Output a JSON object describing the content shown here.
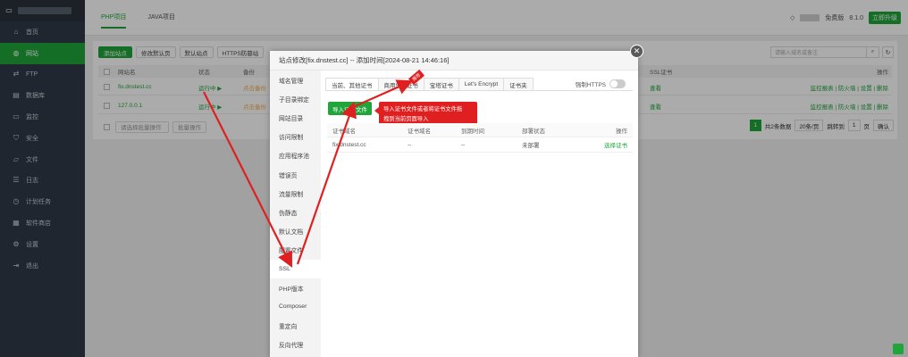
{
  "sidebar": {
    "items": [
      {
        "label": "首页",
        "icon": "home-icon",
        "glyph": "⌂",
        "active": false
      },
      {
        "label": "网站",
        "icon": "globe-icon",
        "glyph": "◍",
        "active": true
      },
      {
        "label": "FTP",
        "icon": "ftp-icon",
        "glyph": "⇄",
        "active": false
      },
      {
        "label": "数据库",
        "icon": "database-icon",
        "glyph": "▤",
        "active": false
      },
      {
        "label": "监控",
        "icon": "monitor-icon",
        "glyph": "▭",
        "active": false
      },
      {
        "label": "安全",
        "icon": "shield-icon",
        "glyph": "⛉",
        "active": false
      },
      {
        "label": "文件",
        "icon": "folder-icon",
        "glyph": "▱",
        "active": false
      },
      {
        "label": "日志",
        "icon": "log-icon",
        "glyph": "☰",
        "active": false
      },
      {
        "label": "计划任务",
        "icon": "clock-icon",
        "glyph": "◷",
        "active": false
      },
      {
        "label": "软件商店",
        "icon": "grid-icon",
        "glyph": "▦",
        "active": false
      },
      {
        "label": "设置",
        "icon": "gear-icon",
        "glyph": "⚙",
        "active": false
      },
      {
        "label": "退出",
        "icon": "logout-icon",
        "glyph": "⇥",
        "active": false
      }
    ]
  },
  "topbar": {
    "tabs": [
      "PHP项目",
      "JAVA项目"
    ],
    "edition": "免费版",
    "version": "8.1.0",
    "upgrade": "立即升级"
  },
  "toolbar": {
    "buttons": [
      "添加站点",
      "修改默认页",
      "默认站点",
      "HTTPS防篡站"
    ],
    "search_placeholder": "请输入域名或备注"
  },
  "site_table": {
    "headers": {
      "name": "网站名",
      "status": "状态",
      "backup": "备份",
      "ssl": "SSL证书",
      "actions": "操作"
    },
    "rows": [
      {
        "name": "fix.dnstest.cc",
        "status": "运行中 ▶",
        "backup": "点击备份",
        "ssl": "查看",
        "actions": "监控报表 | 防火墙 | 设置 | 删除"
      },
      {
        "name": "127.0.0.1",
        "status": "运行中 ▶",
        "backup": "点击备份",
        "ssl": "查看",
        "actions": "监控报表 | 防火墙 | 设置 | 删除"
      }
    ],
    "batch_select": "请选择批量操作",
    "batch_btn": "批量操作"
  },
  "pager": {
    "current": "1",
    "total": "共2条数据",
    "per_page": "20条/页",
    "goto": "跳转到",
    "page_input": "1",
    "page_unit": "页",
    "confirm": "确认"
  },
  "modal": {
    "title": "站点修改[fix.dnstest.cc] -- 添加时间[2024-08-21 14:46:16]",
    "side_items": [
      "域名管理",
      "子目录绑定",
      "网站目录",
      "访问限制",
      "应用程序池",
      "错误页",
      "流量限制",
      "伪静态",
      "默认文档",
      "配置文件",
      "SSL",
      "PHP版本",
      "Composer",
      "重定向",
      "反向代理"
    ],
    "active_side": 10,
    "tabs": [
      "当前、其他证书",
      "商用SSL证书",
      "宝塔证书",
      "Let's Encrypt",
      "证书夹"
    ],
    "force_https": "强制HTTPS",
    "import_btn": "导入证书文件",
    "tooltip_line1": "导入证书文件或者将证书文件拖",
    "tooltip_line2": "拽到当前页面导入",
    "hot": "推荐",
    "table_headers": [
      "证书域名",
      "证书域名",
      "到期时间",
      "部署状态",
      "操作"
    ],
    "row": {
      "domain": "fix.dnstest.cc",
      "cert_domain": "--",
      "expire": "--",
      "status": "未部署",
      "action": "选择证书"
    }
  },
  "colors": {
    "accent": "#20a53a",
    "annotation": "#e02020"
  }
}
